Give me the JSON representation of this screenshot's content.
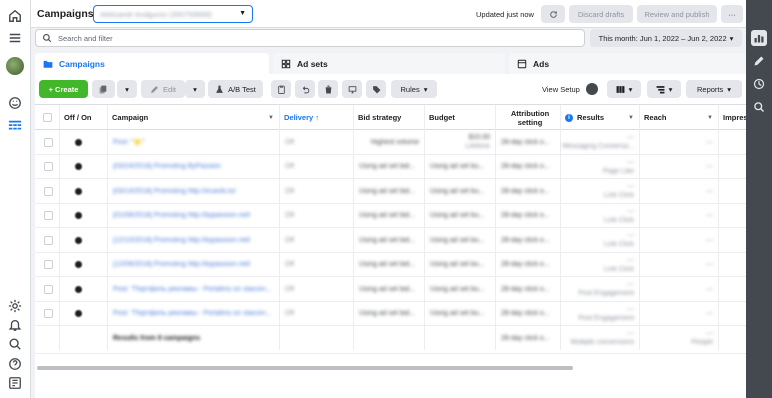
{
  "header": {
    "title": "Campaigns",
    "account": "Aleksandr Andgurov (350759999)",
    "updated": "Updated just now",
    "discard": "Discard drafts",
    "review": "Review and publish",
    "more": "···"
  },
  "search": {
    "placeholder": "Search and filter"
  },
  "daterange": {
    "label": "This month: Jun 1, 2022 – Jun 2, 2022",
    "caret": "▾"
  },
  "tabs": [
    {
      "label": "Campaigns"
    },
    {
      "label": "Ad sets"
    },
    {
      "label": "Ads"
    }
  ],
  "toolbar": {
    "create": "+ Create",
    "edit": "Edit",
    "ab_test": "A/B Test",
    "rules": "Rules",
    "view_setup": "View Setup",
    "reports": "Reports"
  },
  "columns": [
    {
      "label": "Off / On"
    },
    {
      "label": "Campaign"
    },
    {
      "label": "Delivery ↑"
    },
    {
      "label": "Bid strategy"
    },
    {
      "label": "Budget"
    },
    {
      "label": "Attribution setting"
    },
    {
      "label": "Results"
    },
    {
      "label": "Reach"
    },
    {
      "label": "Impres"
    }
  ],
  "rows": [
    {
      "campaign": "Post: \"🌟\"",
      "delivery": "Off",
      "bid": "Highest volume",
      "budget": "$10.00",
      "budget_sub": "Lifetime",
      "attr": "28-day click o...",
      "results": "—",
      "results_sub": "Messaging Conversa...",
      "reach": "—",
      "impr": "—"
    },
    {
      "campaign": "[03/24/2018] Promoting ByPassion",
      "delivery": "Off",
      "bid": "Using ad set bid...",
      "budget": "Using ad set bu...",
      "budget_sub": "",
      "attr": "28-day click o...",
      "results": "—",
      "results_sub": "Page Like",
      "reach": "—",
      "impr": "—"
    },
    {
      "campaign": "[03/14/2018] Promoting http://ecards.to/",
      "delivery": "Off",
      "bid": "Using ad set bid...",
      "budget": "Using ad set bu...",
      "budget_sub": "",
      "attr": "28-day click o...",
      "results": "—",
      "results_sub": "Link Click",
      "reach": "—",
      "impr": "—"
    },
    {
      "campaign": "[01/08/2018] Promoting http://bypassion.net/",
      "delivery": "Off",
      "bid": "Using ad set bid...",
      "budget": "Using ad set bu...",
      "budget_sub": "",
      "attr": "28-day click o...",
      "results": "—",
      "results_sub": "Link Click",
      "reach": "—",
      "impr": "—"
    },
    {
      "campaign": "[12/10/2018] Promoting http://bypassion.net/",
      "delivery": "Off",
      "bid": "Using ad set bid...",
      "budget": "Using ad set bu...",
      "budget_sub": "",
      "attr": "28-day click o...",
      "results": "—",
      "results_sub": "Link Click",
      "reach": "—",
      "impr": "—"
    },
    {
      "campaign": "[12/08/2018] Promoting http://bypassion.net/",
      "delivery": "Off",
      "bid": "Using ad set bid...",
      "budget": "Using ad set bu...",
      "budget_sub": "",
      "attr": "28-day click o...",
      "results": "—",
      "results_sub": "Link Click",
      "reach": "—",
      "impr": "—"
    },
    {
      "campaign": "Post: \"Портфель рекламы - Portafino on stacom...",
      "delivery": "Off",
      "bid": "Using ad set bid...",
      "budget": "Using ad set bu...",
      "budget_sub": "",
      "attr": "28-day click o...",
      "results": "—",
      "results_sub": "Post Engagement",
      "reach": "—",
      "impr": "—"
    },
    {
      "campaign": "Post: \"Портфель рекламы - Portafino on stacom...",
      "delivery": "Off",
      "bid": "Using ad set bid...",
      "budget": "Using ad set bu...",
      "budget_sub": "",
      "attr": "28-day click o...",
      "results": "—",
      "results_sub": "Post Engagement",
      "reach": "—",
      "impr": "—"
    }
  ],
  "summary": {
    "label": "Results from 8 campaigns",
    "attr": "28-day click o...",
    "results": "—",
    "results_sub": "Multiple conversions",
    "reach": "—",
    "reach_sub": "People",
    "impr": "—"
  }
}
